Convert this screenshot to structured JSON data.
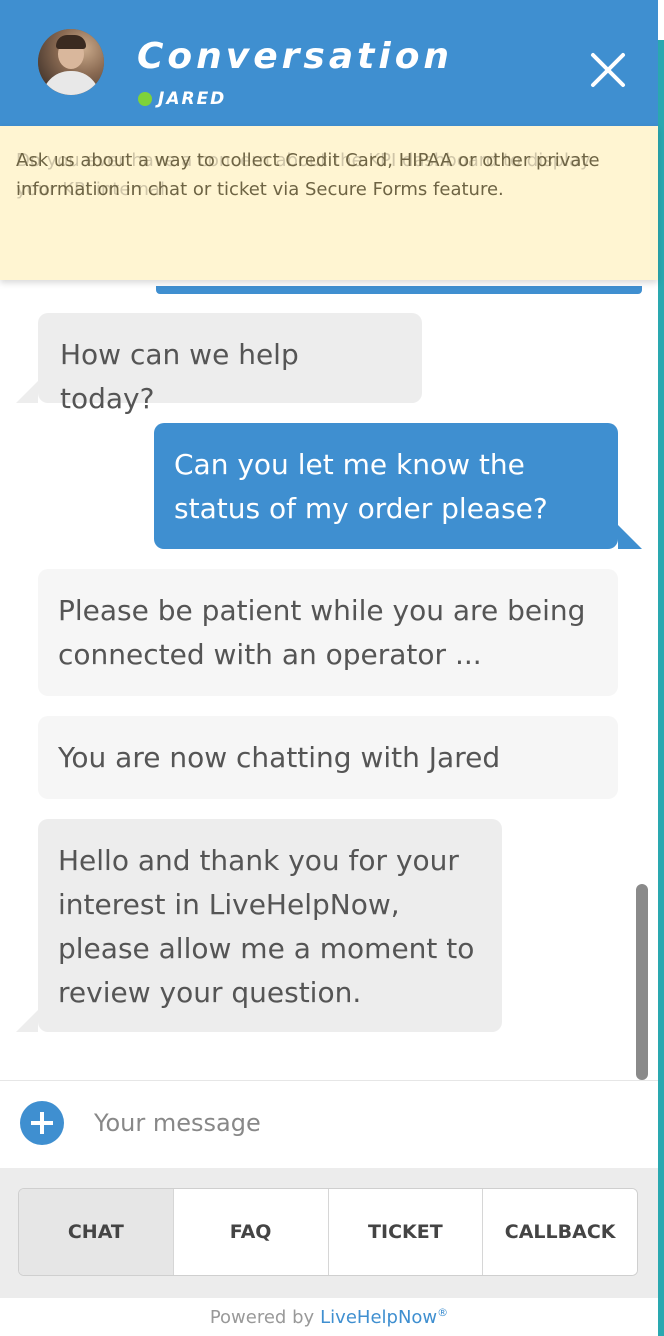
{
  "header": {
    "title": "Conversation",
    "agent_name": "JARED",
    "close_icon": "close-icon"
  },
  "notice": {
    "ghost_text": "Do you ever have a concern about the KPI dashboard to display your KPI internal",
    "text": "Ask us about a way to collect Credit Card, HIPAA or other private information in chat or ticket via Secure Forms feature."
  },
  "messages": [
    {
      "role": "operator",
      "text": "How can we help today?"
    },
    {
      "role": "user",
      "text": "Can you let me know the status of my order please?"
    },
    {
      "role": "system",
      "text": "Please be patient while you are being connected with an operator ..."
    },
    {
      "role": "system",
      "text": "You are now chatting with Jared"
    },
    {
      "role": "operator",
      "text": "Hello and thank you for your interest in LiveHelpNow, please allow me a moment to review your question."
    }
  ],
  "input": {
    "placeholder": "Your message"
  },
  "tabs": [
    {
      "label": "CHAT",
      "active": true
    },
    {
      "label": "FAQ",
      "active": false
    },
    {
      "label": "TICKET",
      "active": false
    },
    {
      "label": "CALLBACK",
      "active": false
    }
  ],
  "footer": {
    "powered_by": "Powered by",
    "brand": "LiveHelpNow",
    "registered": "®"
  },
  "colors": {
    "header": "#3f8fd0",
    "online": "#7ed23a",
    "notice_bg": "#fff5d2",
    "user_bubble": "#3f8fd0",
    "operator_bubble": "#ededed"
  }
}
